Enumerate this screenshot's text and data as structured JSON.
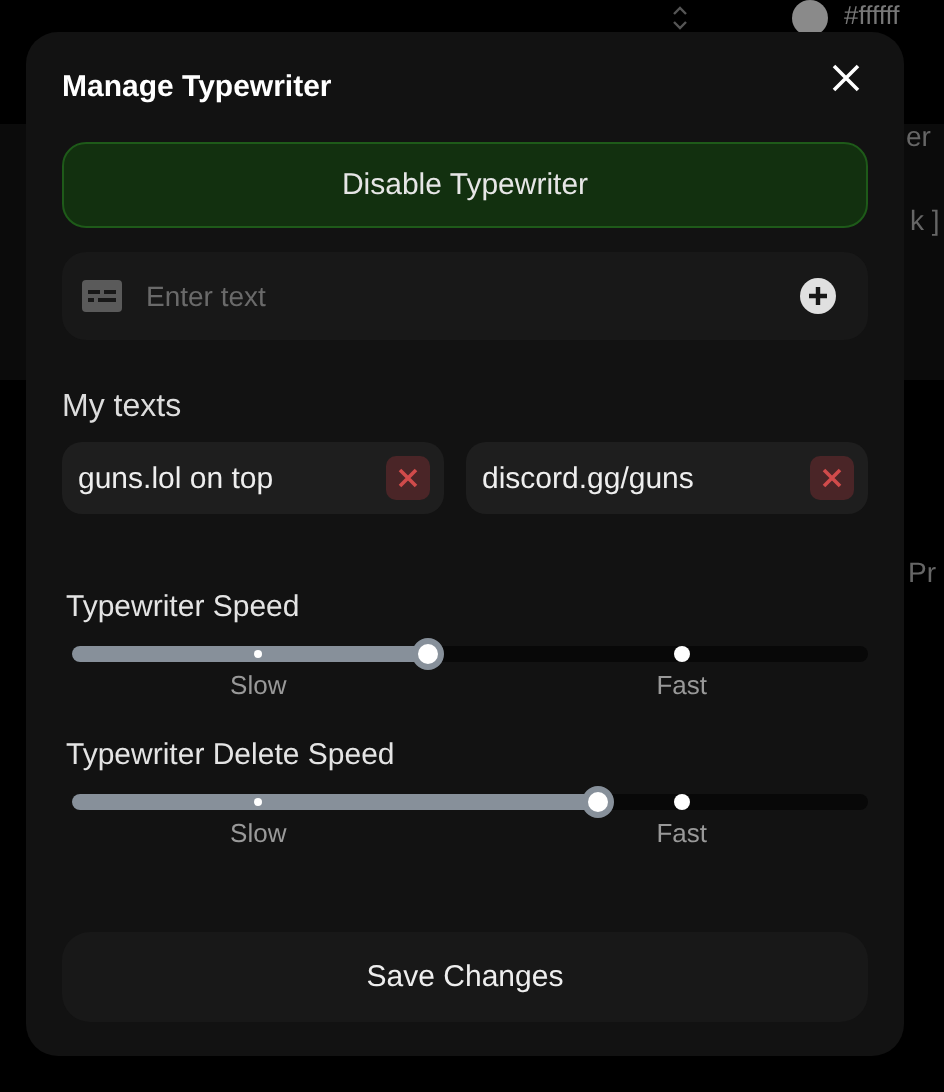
{
  "background": {
    "swatch_value": "#ffffff",
    "fragments": [
      "er",
      "k ]",
      "Pr"
    ]
  },
  "dialog": {
    "title": "Manage Typewriter",
    "toggle_button": "Disable Typewriter",
    "text_input": {
      "placeholder": "Enter text"
    },
    "section_title": "My texts",
    "texts": [
      "guns.lol on top",
      "discord.gg/guns"
    ],
    "sliders": [
      {
        "label": "Typewriter Speed",
        "level": 0.447,
        "marks": [
          "Slow",
          "Fast"
        ]
      },
      {
        "label": "Typewriter Delete Speed",
        "level": 0.661,
        "marks": [
          "Slow",
          "Fast"
        ]
      }
    ],
    "save_button": "Save Changes"
  }
}
